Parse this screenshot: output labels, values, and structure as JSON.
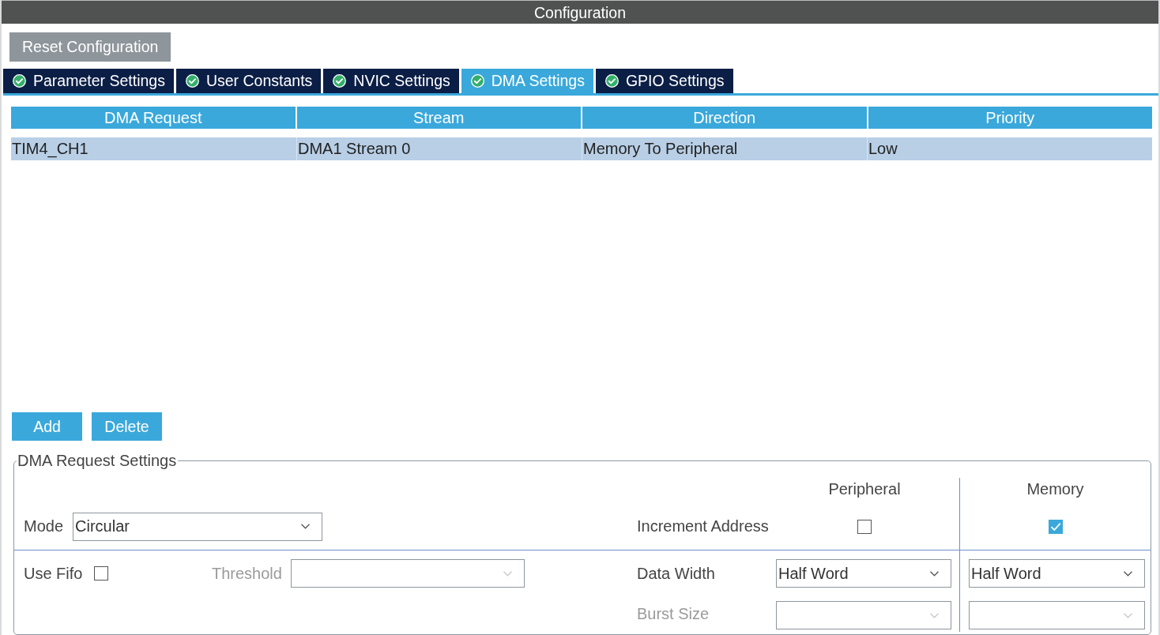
{
  "window": {
    "title": "Configuration"
  },
  "reset_button": "Reset Configuration",
  "tabs": [
    {
      "label": "Parameter Settings",
      "selected": false
    },
    {
      "label": "User Constants",
      "selected": false
    },
    {
      "label": "NVIC Settings",
      "selected": false
    },
    {
      "label": "DMA Settings",
      "selected": true
    },
    {
      "label": "GPIO Settings",
      "selected": false
    }
  ],
  "dma_table": {
    "columns": [
      "DMA Request",
      "Stream",
      "Direction",
      "Priority"
    ],
    "rows": [
      {
        "cells": [
          "TIM4_CH1",
          "DMA1 Stream 0",
          "Memory To Peripheral",
          "Low"
        ],
        "selected": true
      }
    ]
  },
  "buttons": [
    "Add",
    "Delete"
  ],
  "dma_request_settings": {
    "title": "DMA Request Settings",
    "columns": [
      "Peripheral",
      "Memory"
    ],
    "mode": {
      "label": "Mode",
      "value": "Circular"
    },
    "increment_address": {
      "label": "Increment Address",
      "peripheral_checked": false,
      "memory_checked": true
    },
    "use_fifo": {
      "label": "Use Fifo",
      "checked": false
    },
    "threshold": {
      "label": "Threshold",
      "disabled": true
    },
    "data_width": {
      "label": "Data Width",
      "peripheral": "Half Word",
      "memory": "Half Word",
      "disabled": false
    },
    "burst_size": {
      "label": "Burst Size",
      "disabled": true
    }
  }
}
